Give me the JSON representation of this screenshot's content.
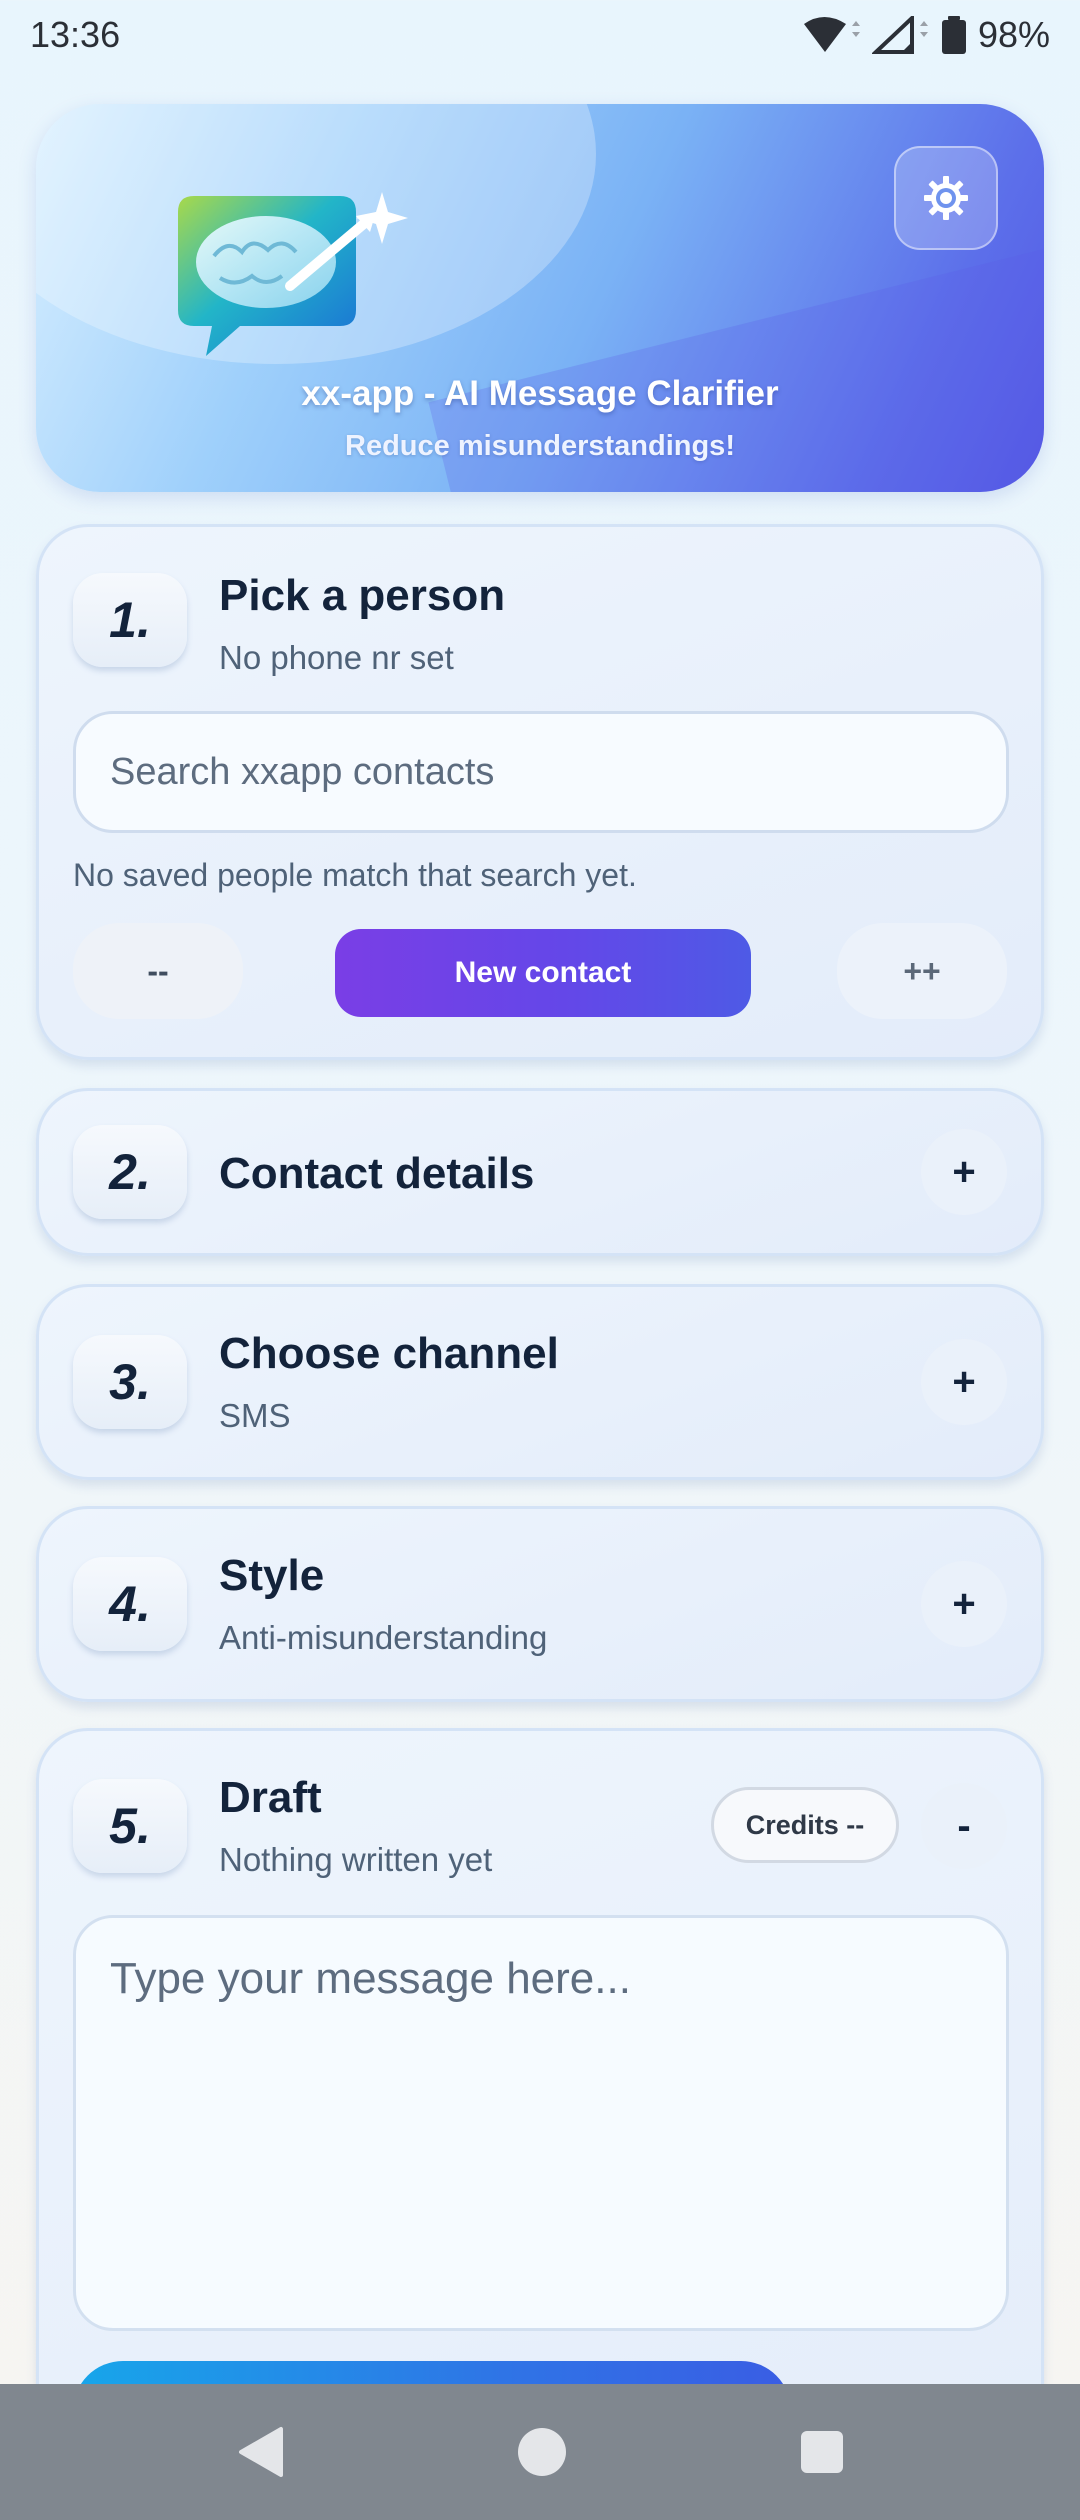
{
  "status_bar": {
    "time": "13:36",
    "battery": "98%"
  },
  "header": {
    "title": "xx-app - AI Message Clarifier",
    "subtitle": "Reduce misunderstandings!"
  },
  "sections": {
    "pick_person": {
      "number": "1.",
      "title": "Pick a person",
      "subtitle": "No phone nr set",
      "search_placeholder": "Search xxapp contacts",
      "empty_note": "No saved people match that search yet.",
      "prev_label": "--",
      "new_contact_label": "New contact",
      "next_label": "++"
    },
    "contact_details": {
      "number": "2.",
      "title": "Contact details",
      "toggle": "+"
    },
    "channel": {
      "number": "3.",
      "title": "Choose channel",
      "subtitle": "SMS",
      "toggle": "+"
    },
    "style": {
      "number": "4.",
      "title": "Style",
      "subtitle": "Anti-misunderstanding",
      "toggle": "+"
    },
    "draft": {
      "number": "5.",
      "title": "Draft",
      "subtitle": "Nothing written yet",
      "credits_label": "Credits --",
      "toggle": "-",
      "placeholder": "Type your message here..."
    }
  },
  "icons": {
    "settings": "gear-icon",
    "wifi": "wifi-icon",
    "signal": "signal-icon",
    "battery": "battery-icon",
    "logo": "brain-chat-logo",
    "nav_back": "back-icon",
    "nav_home": "home-icon",
    "nav_recents": "recents-icon"
  },
  "colors": {
    "accent_purple": "#6447e8",
    "accent_blue": "#2f74e6",
    "text_dark": "#13233b"
  }
}
